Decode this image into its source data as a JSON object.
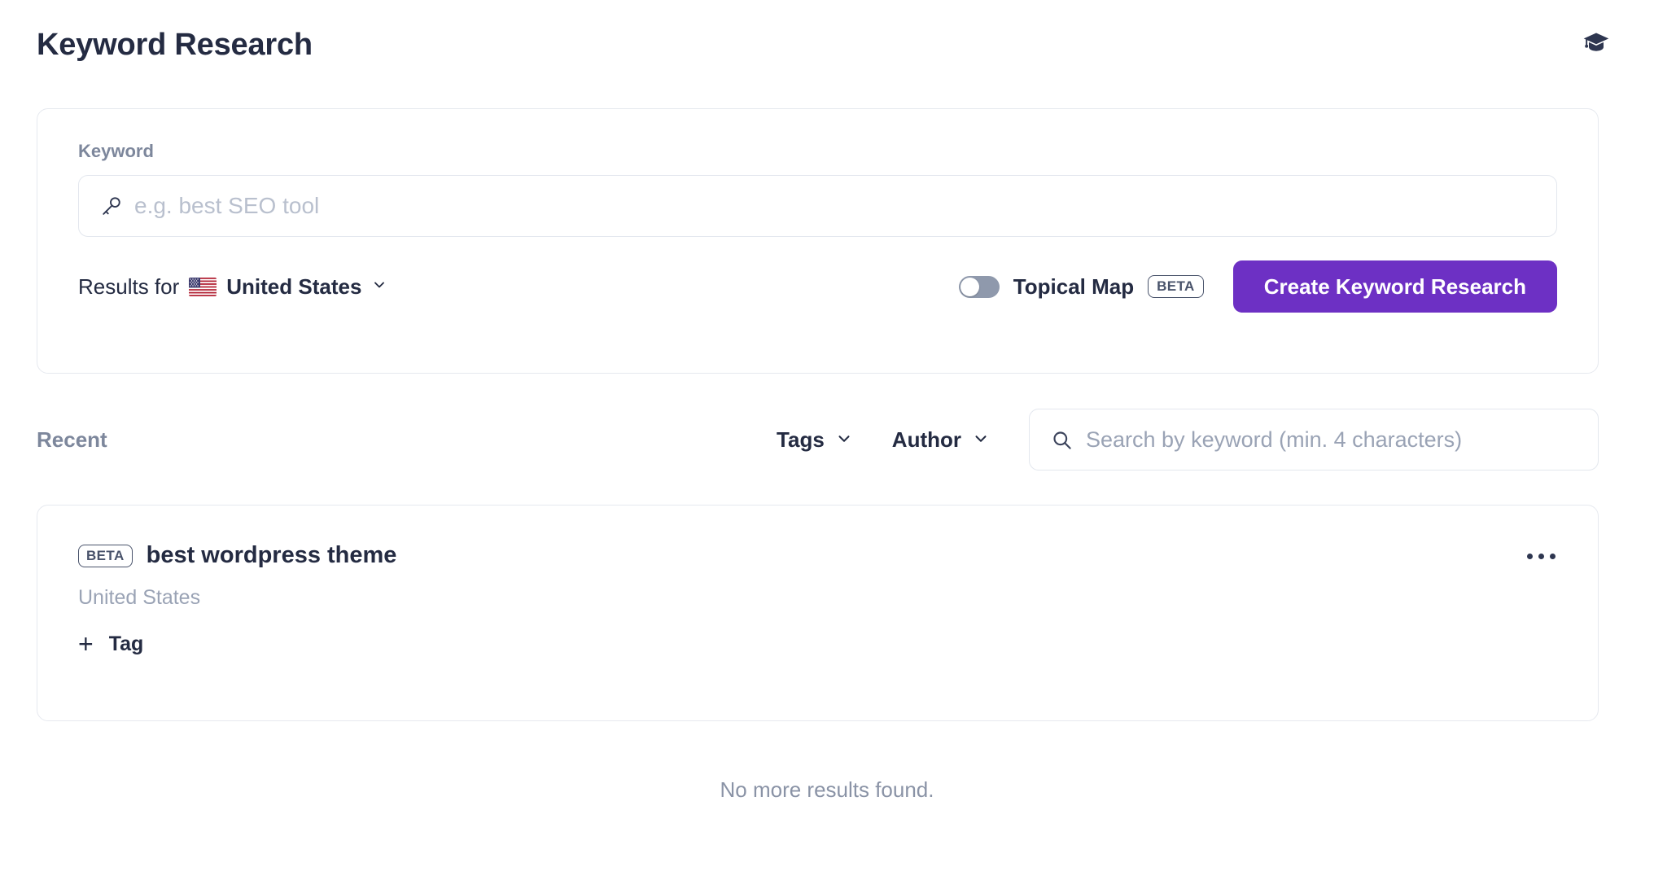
{
  "header": {
    "title": "Keyword Research",
    "academy_icon": "graduation-cap-icon"
  },
  "search_panel": {
    "keyword_label": "Keyword",
    "keyword_icon": "key-icon",
    "keyword_value": "",
    "keyword_placeholder": "e.g. best SEO tool",
    "results_for_label": "Results for",
    "country": "United States",
    "country_flag": "us-flag-icon",
    "country_chevron": "chevron-down-icon",
    "topical_map_label": "Topical Map",
    "topical_map_badge": "BETA",
    "topical_map_enabled": false,
    "create_button": "Create Keyword Research"
  },
  "toolbar": {
    "recent_label": "Recent",
    "tags_label": "Tags",
    "author_label": "Author",
    "chevron_icon": "chevron-down-icon",
    "search_icon": "search-icon",
    "search_value": "",
    "search_placeholder": "Search by keyword (min. 4 characters)"
  },
  "results": [
    {
      "badge": "BETA",
      "title": "best wordpress theme",
      "country": "United States",
      "add_tag_label": "Tag",
      "add_tag_icon": "plus-icon",
      "menu_icon": "more-horizontal-icon"
    }
  ],
  "footer": {
    "empty_text": "No more results found."
  },
  "colors": {
    "accent_purple": "#6D30C4",
    "text_dark": "#242B42",
    "text_muted": "#7D879C",
    "placeholder": "#B9C0CE",
    "border": "#E6E9EF"
  }
}
